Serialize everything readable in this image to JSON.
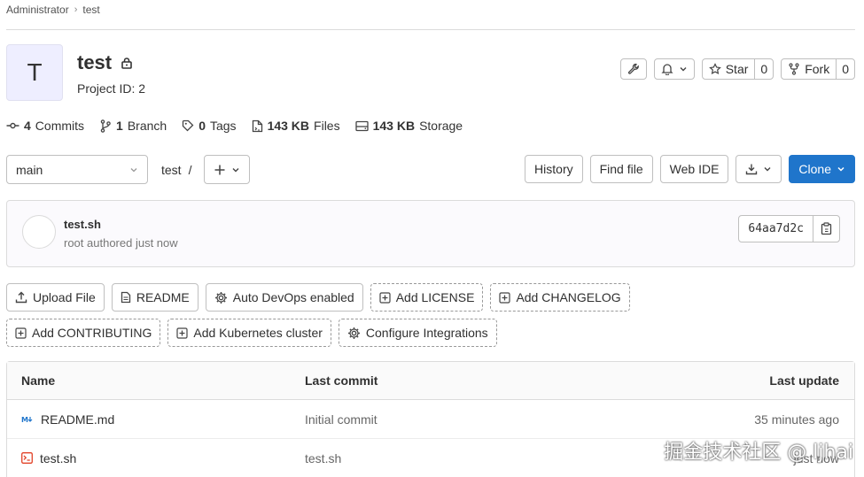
{
  "breadcrumb": {
    "items": [
      "Administrator",
      "test"
    ]
  },
  "project": {
    "avatar_letter": "T",
    "name": "test",
    "id_label": "Project ID: 2"
  },
  "header_actions": {
    "star_label": "Star",
    "star_count": "0",
    "fork_label": "Fork",
    "fork_count": "0"
  },
  "stats": {
    "commits": {
      "value": "4",
      "label": "Commits"
    },
    "branches": {
      "value": "1",
      "label": "Branch"
    },
    "tags": {
      "value": "0",
      "label": "Tags"
    },
    "files": {
      "value": "143 KB",
      "label": "Files"
    },
    "storage": {
      "value": "143 KB",
      "label": "Storage"
    }
  },
  "toolbar": {
    "branch": "main",
    "path_root": "test",
    "path_sep": "/",
    "history": "History",
    "find_file": "Find file",
    "web_ide": "Web IDE",
    "clone": "Clone"
  },
  "last_commit": {
    "title": "test.sh",
    "meta": "root authored just now",
    "sha": "64aa7d2c"
  },
  "quick_actions": {
    "upload": "Upload File",
    "readme": "README",
    "autodevops": "Auto DevOps enabled",
    "license": "Add LICENSE",
    "changelog": "Add CHANGELOG",
    "contributing": "Add CONTRIBUTING",
    "kubernetes": "Add Kubernetes cluster",
    "integrations": "Configure Integrations"
  },
  "tree": {
    "headers": {
      "name": "Name",
      "last_commit": "Last commit",
      "last_update": "Last update"
    },
    "rows": [
      {
        "name": "README.md",
        "commit": "Initial commit",
        "updated": "35 minutes ago"
      },
      {
        "name": "test.sh",
        "commit": "test.sh",
        "updated": "just now"
      }
    ]
  },
  "watermark": "掘金技术社区 @ ljhai",
  "colors": {
    "primary": "#1f75cb",
    "shell_icon": "#e24329",
    "markdown_icon": "#1f75cb"
  }
}
